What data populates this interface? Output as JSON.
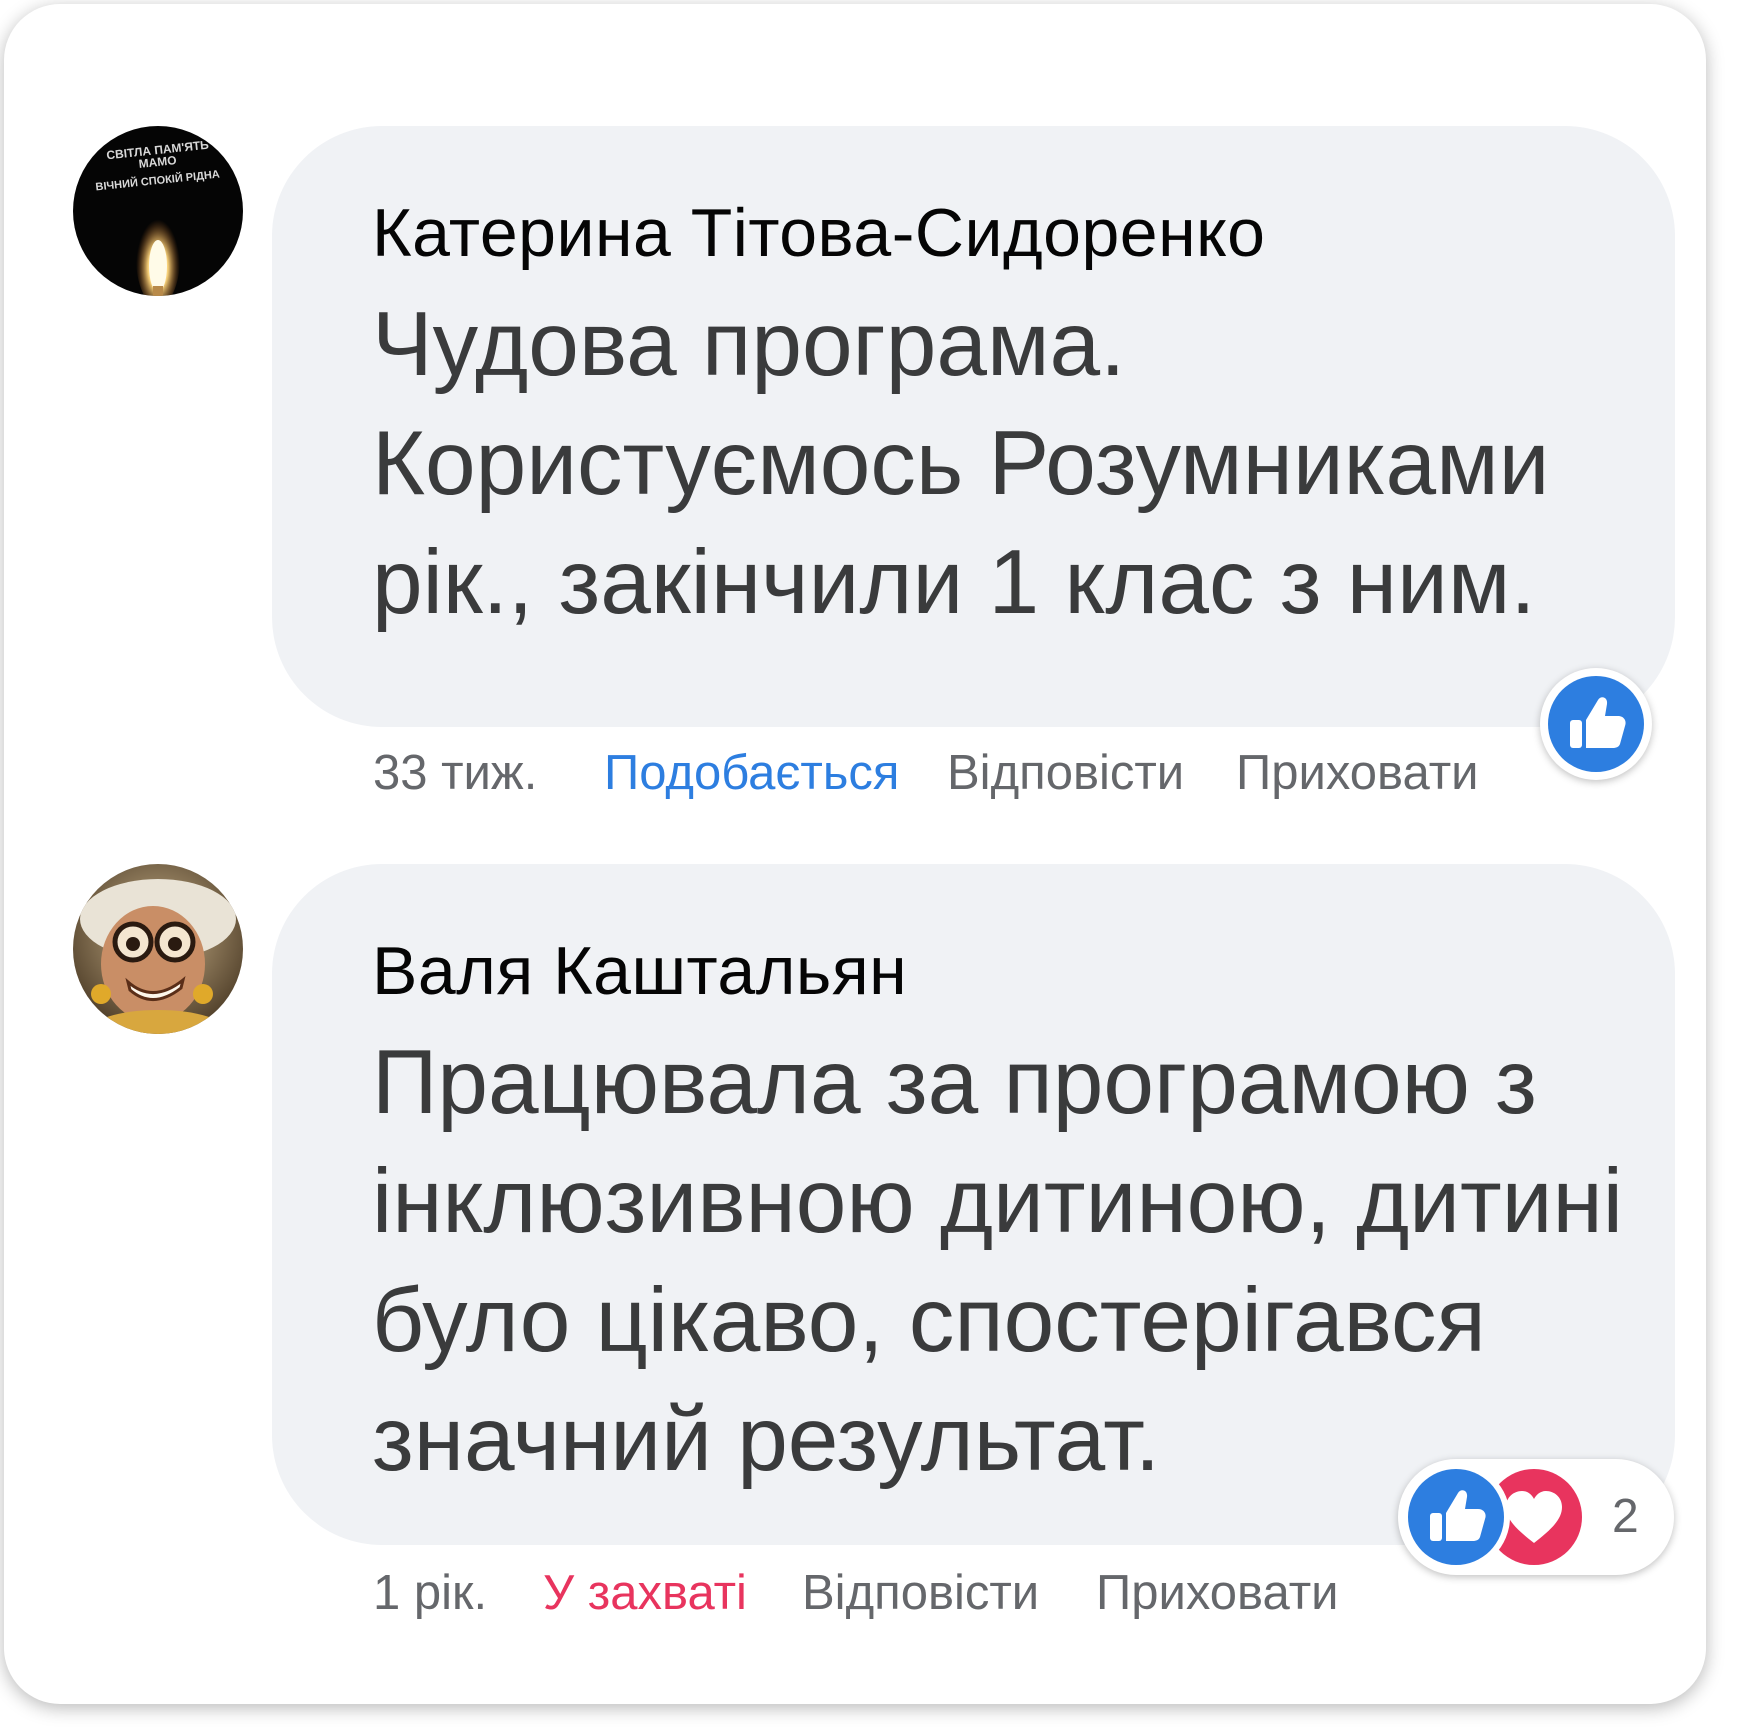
{
  "comments": [
    {
      "author": "Катерина Тітова-Сидоренко",
      "avatar_icon": "memorial-candle-avatar",
      "avatar_text": [
        "СВІТЛА ПАМ'ЯТЬ",
        "МАМО",
        "ВІЧНИЙ СПОКІЙ РІДНА"
      ],
      "text_lines": [
        "Чудова програма.",
        "Користуємось Розумниками",
        "рік., закінчили 1 клас з ним."
      ],
      "time": "33 тиж.",
      "like_label": "Подобається",
      "reply_label": "Відповісти",
      "hide_label": "Приховати",
      "reactions": [
        "like-icon"
      ]
    },
    {
      "author": "Валя Каштальян",
      "avatar_icon": "grandma-with-glasses-avatar",
      "text_lines": [
        "Працювала за програмою з",
        "інклюзивною дитиною, дитині",
        "було цікаво, спостерігався",
        "значний результат."
      ],
      "time": "1 рік.",
      "like_label": "У захваті",
      "reply_label": "Відповісти",
      "hide_label": "Приховати",
      "reactions": [
        "like-icon",
        "love-icon"
      ],
      "reaction_count": "2"
    }
  ],
  "colors": {
    "bubble": "#f0f2f5",
    "like_blue": "#2d7ee0",
    "love_red": "#e8345e",
    "meta_gray": "#65676b"
  }
}
